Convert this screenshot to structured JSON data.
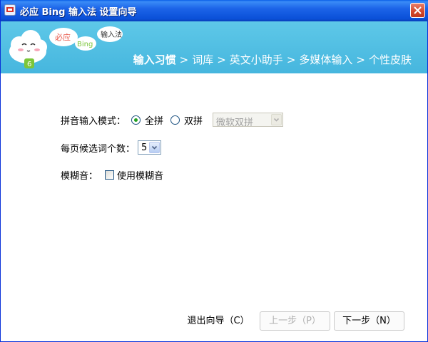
{
  "window": {
    "title": "必应 Bing 输入法 设置向导"
  },
  "banner": {
    "logo_texts": [
      "必应",
      "Bing",
      "输入法"
    ],
    "steps": [
      "输入习惯",
      "词库",
      "英文小助手",
      "多媒体输入",
      "个性皮肤"
    ],
    "separator": ">",
    "current_step": 0
  },
  "form": {
    "pinyin_mode_label": "拼音输入模式：",
    "option_full": "全拼",
    "option_double": "双拼",
    "selected_mode": "全拼",
    "double_scheme_value": "微软双拼",
    "candidates_label": "每页候选词个数：",
    "candidates_value": "5",
    "fuzzy_label": "模糊音：",
    "fuzzy_checkbox_label": "使用模糊音",
    "fuzzy_checked": false
  },
  "footer": {
    "exit_label": "退出向导（C）",
    "prev_label": "上一步（P）",
    "next_label": "下一步（N）"
  },
  "colors": {
    "banner": "#4cbbe1",
    "titlebar": "#0a50d8",
    "radio_dot": "#21a121"
  }
}
